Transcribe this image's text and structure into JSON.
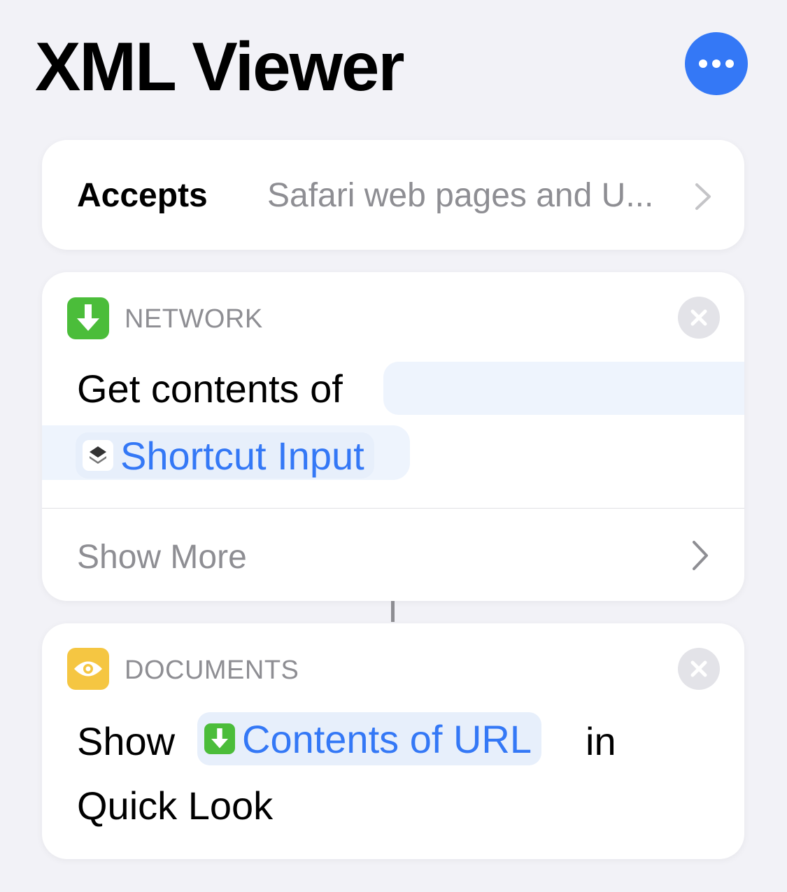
{
  "header": {
    "title": "XML Viewer",
    "more_icon": "ellipsis-icon",
    "accent": "#3478f6"
  },
  "accepts": {
    "label": "Accepts",
    "value": "Safari web pages and U...",
    "chevron_icon": "chevron-right-icon"
  },
  "actions": [
    {
      "category": "NETWORK",
      "category_icon": "download-arrow-icon",
      "category_color": "#4bbd3a",
      "text_before": "Get contents of",
      "token": {
        "label": "Shortcut Input",
        "icon": "shortcuts-icon"
      },
      "show_more": "Show More",
      "close_icon": "close-icon"
    },
    {
      "category": "DOCUMENTS",
      "category_icon": "eye-icon",
      "category_color": "#f5c642",
      "text_before": "Show",
      "token": {
        "label": "Contents of URL",
        "icon": "download-arrow-icon"
      },
      "text_after": "in",
      "text_line2": "Quick Look",
      "close_icon": "close-icon"
    }
  ]
}
